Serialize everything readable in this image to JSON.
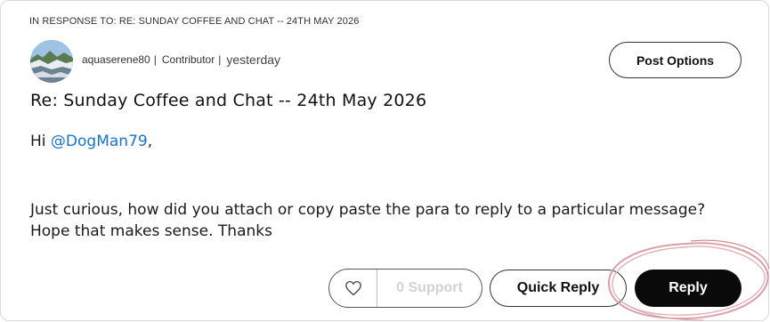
{
  "post": {
    "in_response_to": "IN RESPONSE TO: RE: SUNDAY COFFEE AND CHAT -- 24TH MAY 2026",
    "author": {
      "username": "aquaserene80",
      "role": "Contributor",
      "time": "yesterday"
    },
    "post_options_label": "Post Options",
    "subject": "Re: Sunday Coffee and Chat -- 24th May 2026",
    "body": {
      "greeting_prefix": "Hi ",
      "mention": "@DogMan79",
      "greeting_suffix": ",",
      "paragraph": "Just curious, how did you attach or copy paste the para to reply to a particular message? Hope that makes sense. Thanks"
    }
  },
  "actions": {
    "heart_icon": "heart-outline",
    "support_label": "0 Support",
    "quick_reply_label": "Quick Reply",
    "reply_label": "Reply"
  },
  "colors": {
    "mention": "#1a73c8",
    "reply_bg": "#0a0a0a",
    "annotation": "#d9a0a8"
  }
}
